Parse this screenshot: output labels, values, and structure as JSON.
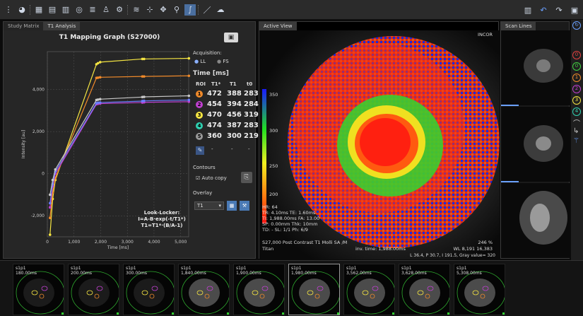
{
  "toolbar": {
    "icons": [
      "grip-icon",
      "gauge-icon",
      "grid-icon",
      "layout-icon",
      "layout2-icon",
      "wave-icon",
      "bars-icon",
      "person-icon",
      "gear-icon",
      "chart-icon",
      "split-icon",
      "move-icon",
      "zoom-icon",
      "curve-icon",
      "measure-icon",
      "cloud-icon",
      "monitor-icon",
      "undo-icon",
      "redo-icon",
      "camera-icon"
    ]
  },
  "left_panel": {
    "tabs": [
      "Study Matrix",
      "T1 Analysis"
    ],
    "graph_title": "T1 Mapping Graph (S27000)"
  },
  "chart_data": {
    "type": "line",
    "title": "T1 Mapping Graph (S27000)",
    "xlabel": "Time [ms]",
    "ylabel": "Intensity [au]",
    "xlim": [
      0,
      5300
    ],
    "ylim": [
      -3000,
      5800
    ],
    "xticks": [
      0,
      1000,
      2000,
      3000,
      4000,
      5000
    ],
    "yticks": [
      -2000,
      0,
      2000,
      4000
    ],
    "xtick_labels": [
      "0",
      "1,000",
      "2,000",
      "3,000",
      "4,000",
      "5,000"
    ],
    "ytick_labels": [
      "-2,000",
      "0",
      "2,000",
      "4,000"
    ],
    "grid": true,
    "series": [
      {
        "color": "#f5e542",
        "x": [
          100,
          200,
          300,
          1840,
          1900,
          1980,
          3562,
          3628,
          5308
        ],
        "y": [
          -2900,
          -1200,
          -300,
          5200,
          5250,
          5300,
          5450,
          5450,
          5480
        ]
      },
      {
        "color": "#f08a2a",
        "x": [
          100,
          200,
          300,
          1840,
          1900,
          1980,
          3562,
          3628,
          5308
        ],
        "y": [
          -2100,
          -900,
          -200,
          4550,
          4560,
          4580,
          4620,
          4620,
          4650
        ]
      },
      {
        "color": "#c040d0",
        "x": [
          100,
          200,
          300,
          1840,
          1900,
          1980,
          3562,
          3628,
          5308
        ],
        "y": [
          -1600,
          -600,
          0,
          3300,
          3320,
          3330,
          3380,
          3390,
          3420
        ]
      },
      {
        "color": "#6a7dff",
        "x": [
          100,
          200,
          300,
          1840,
          1900,
          1980,
          3562,
          3628,
          5308
        ],
        "y": [
          -1400,
          -500,
          100,
          3350,
          3370,
          3380,
          3450,
          3460,
          3500
        ]
      },
      {
        "color": "#c8c8c8",
        "x": [
          100,
          200,
          300,
          1840,
          1900,
          1980,
          3562,
          3628,
          5308
        ],
        "y": [
          -1000,
          -300,
          200,
          3500,
          3520,
          3540,
          3640,
          3650,
          3700
        ]
      }
    ],
    "annotations": [
      "Look-Locker:",
      "I=A-B·exp(-t/T1*)",
      "T1=T1*·(B/A-1)"
    ]
  },
  "controls": {
    "acquisition_label": "Acquisition:",
    "ll": "LL",
    "fs": "FS",
    "time_label": "Time [ms]",
    "cols": [
      "ROI",
      "T1*",
      "T1",
      "t0"
    ],
    "rows": [
      {
        "id": "1",
        "t1s": "472",
        "t1": "388",
        "t0": "283",
        "color": "#f08a2a"
      },
      {
        "id": "2",
        "t1s": "454",
        "t1": "394",
        "t0": "284",
        "color": "#c040d0"
      },
      {
        "id": "3",
        "t1s": "470",
        "t1": "456",
        "t0": "319",
        "color": "#f5e542"
      },
      {
        "id": "4",
        "t1s": "474",
        "t1": "387",
        "t0": "283",
        "color": "#2fd0b0"
      },
      {
        "id": "5",
        "t1s": "360",
        "t1": "300",
        "t0": "219",
        "color": "#999999"
      }
    ],
    "dash_row": [
      "-",
      "-",
      "-"
    ],
    "contours_label": "Contours",
    "auto_copy": "Auto copy",
    "overlay_label": "Overlay",
    "overlay_value": "T1"
  },
  "active_view": {
    "tab": "Active View",
    "corner": "INCOR",
    "scale": [
      "350",
      "300",
      "250",
      "200"
    ],
    "info": "HR: 64\nTR: 4.10ms TE: 1.60ms\nTI: 1,988.00ms FA: 13.00\nSP: 0.00mm Thk: 10mm\nTD: - SL: 1/1 Ph: 6/9",
    "series_desc": "S27,000 Post Contrast T1 Molli SA /M",
    "scanner": "Titan",
    "inv_time": "inv. time: 1,988.00ms",
    "zoom": "246 %",
    "wl": "WL 8,191 16,383",
    "status": "L 36.4, P 30.7, I 191.5, Gray value= 320"
  },
  "scan_lines": {
    "tab": "Scan Lines"
  },
  "right_strip": {
    "labels": [
      "0",
      "0",
      "1",
      "2",
      "3",
      "4"
    ],
    "colors": [
      "#e04040",
      "#40d040",
      "#f08a2a",
      "#c040d0",
      "#f5e542",
      "#2fd0b0"
    ]
  },
  "thumbnails": [
    {
      "label": "s1p1",
      "time": "180.00ms"
    },
    {
      "label": "s1p1",
      "time": "200.00ms"
    },
    {
      "label": "s1p1",
      "time": "300.00ms"
    },
    {
      "label": "s1p1",
      "time": "1,840.00ms"
    },
    {
      "label": "s1p1",
      "time": "1,900.00ms"
    },
    {
      "label": "s1p1",
      "time": "1,980.00ms"
    },
    {
      "label": "s1p1",
      "time": "3,562.00ms"
    },
    {
      "label": "s1p1",
      "time": "3,628.00ms"
    },
    {
      "label": "s1p1",
      "time": "5,308.00ms"
    }
  ]
}
